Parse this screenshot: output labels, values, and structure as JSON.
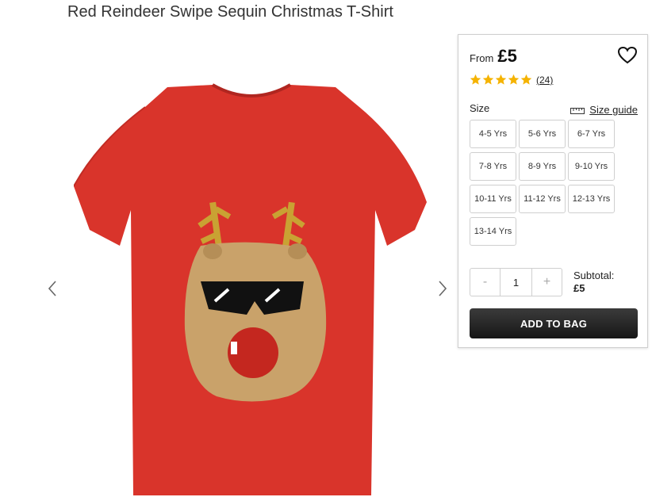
{
  "product": {
    "title": "Red Reindeer Swipe Sequin Christmas T-Shirt"
  },
  "gallery": {
    "image_alt": "red-tshirt-with-sequin-reindeer",
    "prev_icon": "chevron-left-icon",
    "next_icon": "chevron-right-icon"
  },
  "purchase": {
    "from_label": "From",
    "price": "£5",
    "rating_stars": 5,
    "rating_max": 5,
    "review_count": "(24)",
    "size_label": "Size",
    "size_guide_label": "Size guide",
    "sizes": [
      "4-5 Yrs",
      "5-6 Yrs",
      "6-7 Yrs",
      "7-8 Yrs",
      "8-9 Yrs",
      "9-10 Yrs",
      "10-11 Yrs",
      "11-12 Yrs",
      "12-13 Yrs",
      "13-14 Yrs"
    ],
    "qty_minus": "-",
    "qty_plus": "+",
    "qty_value": "1",
    "subtotal_label": "Subtotal:",
    "subtotal_value": "£5",
    "add_to_bag_label": "ADD TO BAG"
  },
  "colors": {
    "shirt": "#d9342b",
    "star": "#f5b301",
    "button": "#1f1f1f"
  }
}
